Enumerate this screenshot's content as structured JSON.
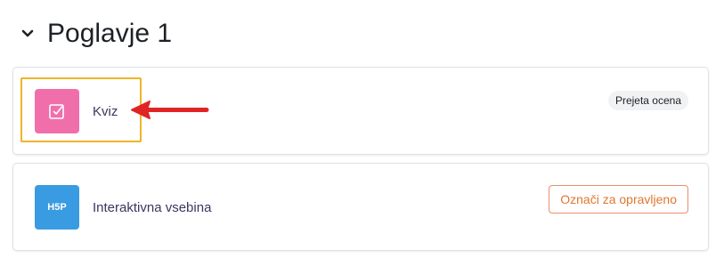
{
  "section": {
    "title": "Poglavje 1"
  },
  "activities": [
    {
      "name": "Kviz",
      "icon": "quiz-checkbox-icon",
      "icon_color": "#f06fab",
      "badge": "Prejeta ocena"
    },
    {
      "name": "Interaktivna vsebina",
      "icon": "h5p-icon",
      "icon_color": "#399be2",
      "icon_text": "H5P",
      "completion_button": "Označi za opravljeno"
    }
  ],
  "annotation": {
    "highlight_color": "#f0b429",
    "arrow_color": "#e02424"
  }
}
